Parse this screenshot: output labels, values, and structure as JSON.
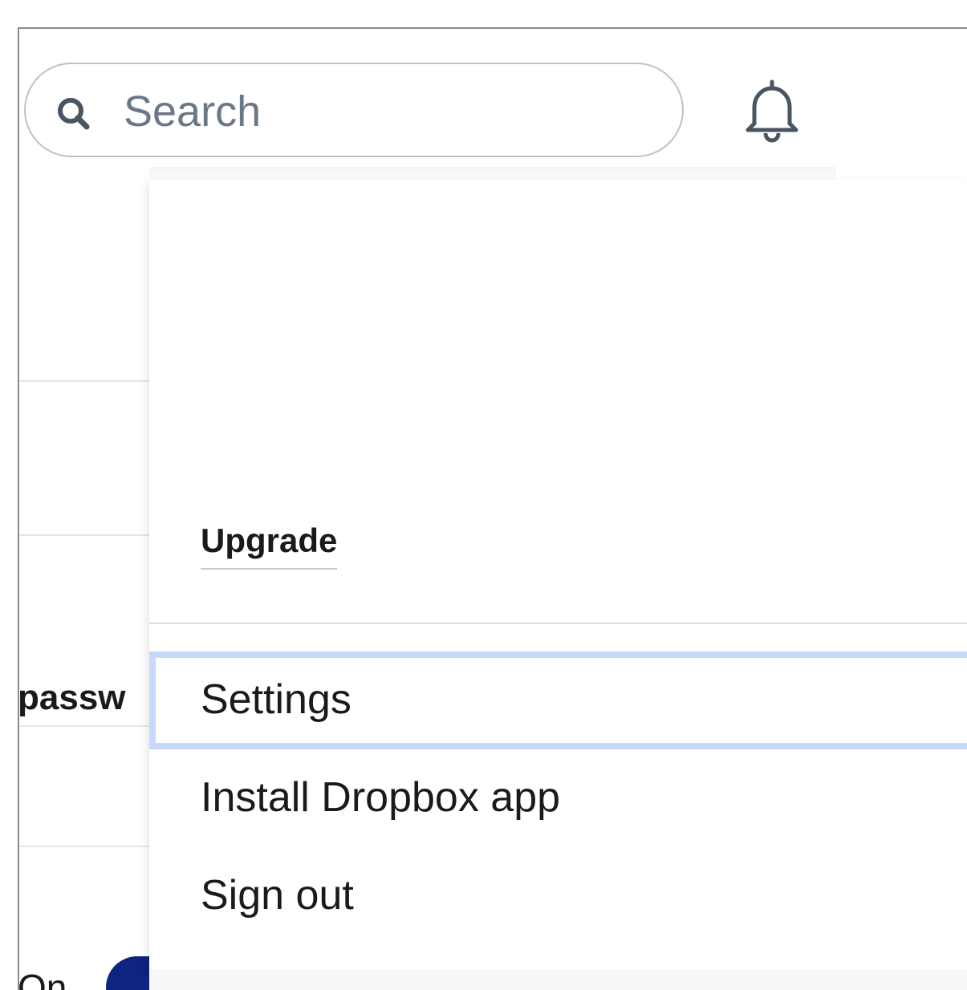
{
  "header": {
    "search": {
      "placeholder": "Search",
      "icon": "search-icon"
    },
    "notifications_icon": "bell-icon"
  },
  "background_page": {
    "password_label_fragment": "passw",
    "toggle_label_fragment": "On",
    "toggle_state": "on",
    "toggle_color": "#0d2481"
  },
  "account_menu": {
    "upgrade_label": "Upgrade",
    "items": [
      {
        "label": "Settings",
        "selected": true
      },
      {
        "label": "Install Dropbox app",
        "selected": false
      },
      {
        "label": "Sign out",
        "selected": false
      }
    ],
    "selection_color": "#c6d9fb"
  }
}
